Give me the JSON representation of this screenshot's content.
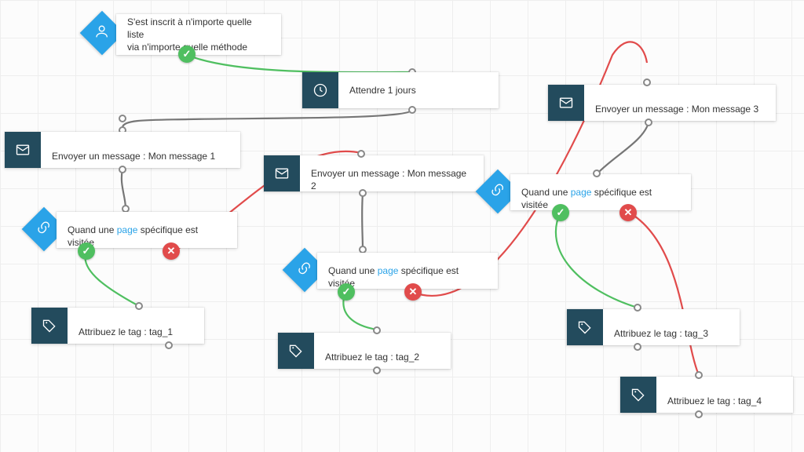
{
  "colors": {
    "diamond": "#2aa3e8",
    "dark_panel": "#234b5d",
    "ok": "#4fbf60",
    "no": "#e14b4b",
    "neutral_line": "#767676"
  },
  "nodes": {
    "trigger": {
      "label": "S'est inscrit à n'importe quelle liste\nvia n'importe quelle méthode",
      "icon": "person-icon"
    },
    "wait": {
      "label": "Attendre 1 jours",
      "icon": "clock-icon"
    },
    "msg1": {
      "prefix": "Envoyer un message : ",
      "value": "Mon message 1",
      "icon": "mail-icon"
    },
    "msg2": {
      "prefix": "Envoyer un message : ",
      "value": "Mon message 2",
      "icon": "mail-icon"
    },
    "msg3": {
      "prefix": "Envoyer un message : ",
      "value": "Mon message 3",
      "icon": "mail-icon"
    },
    "cond1": {
      "pre": "Quand une ",
      "link": "page",
      "post": " spécifique est visitée",
      "icon": "link-icon"
    },
    "cond2": {
      "pre": "Quand une ",
      "link": "page",
      "post": " spécifique est visitée",
      "icon": "link-icon"
    },
    "cond3": {
      "pre": "Quand une ",
      "link": "page",
      "post": " spécifique est visitée",
      "icon": "link-icon"
    },
    "tag1": {
      "prefix": "Attribuez le tag : ",
      "value": "tag_1",
      "icon": "tag-icon"
    },
    "tag2": {
      "prefix": "Attribuez le tag : ",
      "value": "tag_2",
      "icon": "tag-icon"
    },
    "tag3": {
      "prefix": "Attribuez le tag : ",
      "value": "tag_3",
      "icon": "tag-icon"
    },
    "tag4": {
      "prefix": "Attribuez le tag : ",
      "value": "tag_4",
      "icon": "tag-icon"
    }
  },
  "badges": {
    "check": "✓",
    "cross": "✕"
  }
}
